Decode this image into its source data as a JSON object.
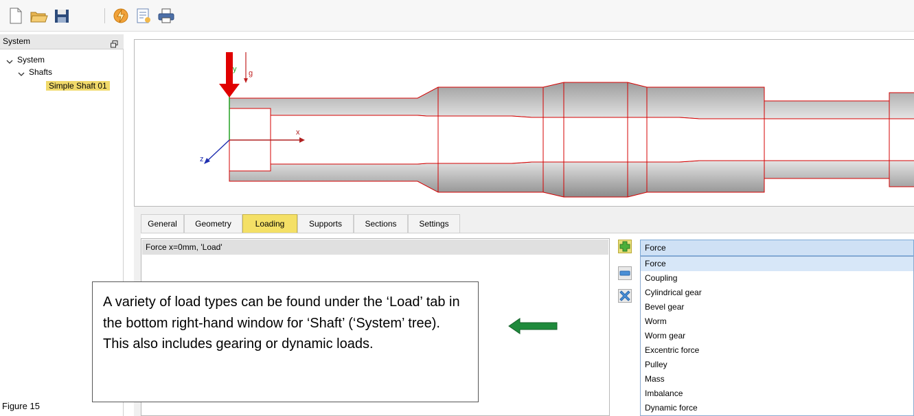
{
  "toolbar": {
    "icons": [
      "new-file-icon",
      "open-folder-icon",
      "save-icon",
      "calculate-icon",
      "report-icon",
      "print-icon"
    ]
  },
  "system_panel": {
    "title": "System",
    "tree": {
      "root": "System",
      "group": "Shafts",
      "selected": "Simple Shaft 01"
    }
  },
  "viewport": {
    "axis_labels": {
      "y": "y",
      "g": "g",
      "x": "x",
      "z": "z"
    },
    "colors": {
      "force_arrow": "#e00000",
      "outline": "#d40000",
      "y_axis": "#20a020",
      "x_axis": "#b02020",
      "z_axis": "#1f2fb0"
    }
  },
  "tabs": [
    {
      "label": "General",
      "active": false
    },
    {
      "label": "Geometry",
      "active": false
    },
    {
      "label": "Loading",
      "active": true
    },
    {
      "label": "Supports",
      "active": false
    },
    {
      "label": "Sections",
      "active": false
    },
    {
      "label": "Settings",
      "active": false
    }
  ],
  "loads": {
    "items": [
      "Force x=0mm, 'Load'"
    ]
  },
  "buttons": {
    "icons": [
      "add-icon",
      "remove-icon",
      "delete-icon"
    ]
  },
  "load_type": {
    "selected": "Force",
    "options": [
      "Force",
      "Coupling",
      "Cylindrical gear",
      "Bevel gear",
      "Worm",
      "Worm gear",
      "Excentric force",
      "Pulley",
      "Mass",
      "Imbalance",
      "Dynamic force"
    ]
  },
  "callout": {
    "text": "A variety of load types can be found under the ‘Load’ tab in the bottom right-hand window for ‘Shaft’ (‘System’ tree). This also includes gearing or dynamic loads."
  },
  "figure_caption": "Figure 15",
  "accent": {
    "tab_active": "#f4e066",
    "selection": "#f0d96a",
    "arrow": "#1f8a3c"
  }
}
